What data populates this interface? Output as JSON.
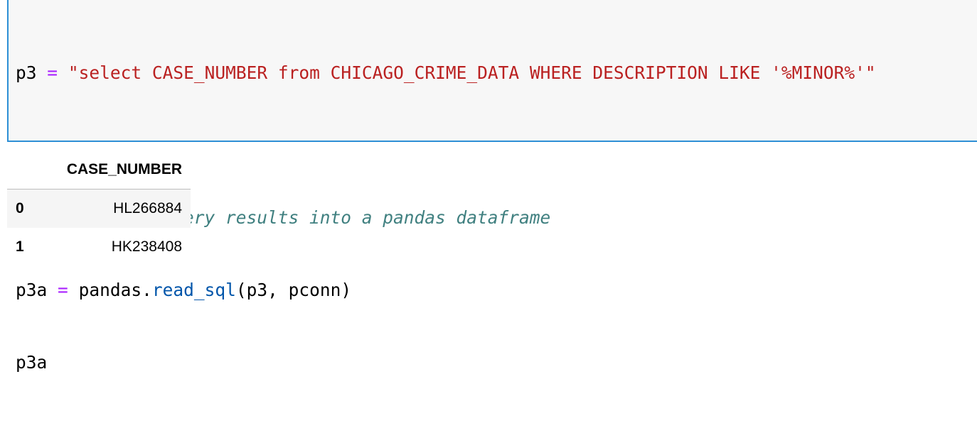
{
  "cell": {
    "lines": {
      "l1": {
        "var": "p3",
        "op": "=",
        "str": "\"select CASE_NUMBER from CHICAGO_CRIME_DATA WHERE DESCRIPTION LIKE '%MINOR%'\""
      },
      "l2": "",
      "l3": "#retrieve the query results into a pandas dataframe",
      "l4": {
        "var": "p3a",
        "op": "=",
        "obj": "pandas.",
        "fn": "read_sql",
        "args": "(p3, pconn)"
      },
      "l5": "p3a"
    }
  },
  "output": {
    "columns": [
      "",
      "CASE_NUMBER"
    ],
    "rows": [
      {
        "index": "0",
        "case_number": "HL266884"
      },
      {
        "index": "1",
        "case_number": "HK238408"
      }
    ]
  },
  "colors": {
    "cell_border": "#2d8fd5",
    "operator": "#aa22ff",
    "string": "#ba2121",
    "comment": "#408080",
    "function": "#0055aa"
  }
}
